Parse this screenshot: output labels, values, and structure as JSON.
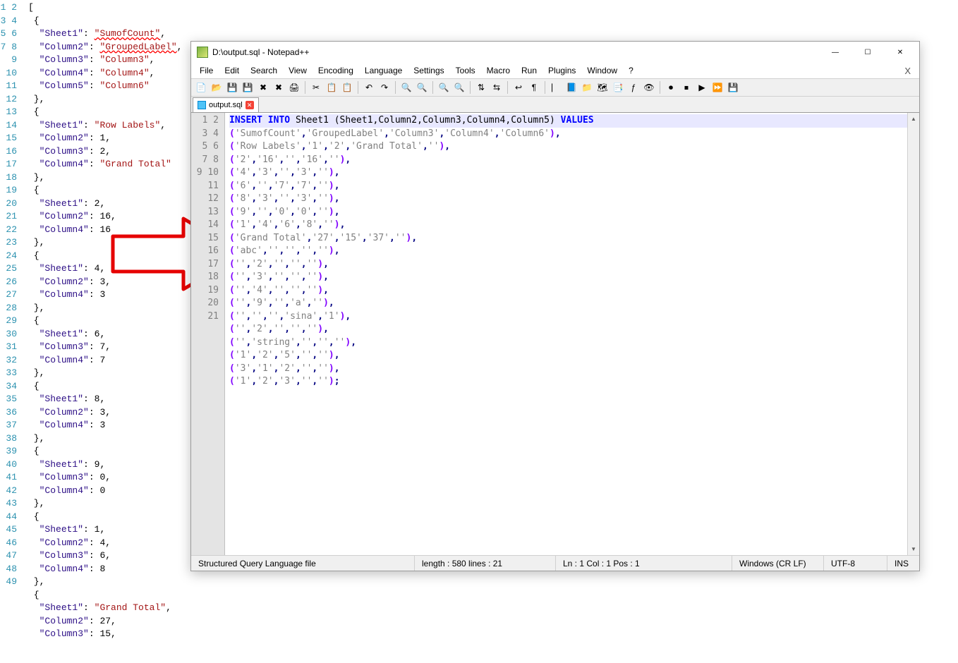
{
  "left_editor": {
    "lines": [
      {
        "n": 1,
        "raw": "["
      },
      {
        "n": 2,
        "raw": " {"
      },
      {
        "n": 3,
        "key": "Sheet1",
        "strval": "SumofCount",
        "comma": true,
        "squiggle": true
      },
      {
        "n": 4,
        "key": "Column2",
        "strval": "GroupedLabel",
        "comma": true,
        "squiggle": true
      },
      {
        "n": 5,
        "key": "Column3",
        "strval": "Column3",
        "comma": true
      },
      {
        "n": 6,
        "key": "Column4",
        "strval": "Column4",
        "comma": true
      },
      {
        "n": 7,
        "key": "Column5",
        "strval": "Column6"
      },
      {
        "n": 8,
        "raw": " },"
      },
      {
        "n": 9,
        "raw": " {"
      },
      {
        "n": 10,
        "key": "Sheet1",
        "strval": "Row Labels",
        "comma": true
      },
      {
        "n": 11,
        "key": "Column2",
        "numval": "1",
        "comma": true
      },
      {
        "n": 12,
        "key": "Column3",
        "numval": "2",
        "comma": true
      },
      {
        "n": 13,
        "key": "Column4",
        "strval": "Grand Total"
      },
      {
        "n": 14,
        "raw": " },"
      },
      {
        "n": 15,
        "raw": " {"
      },
      {
        "n": 16,
        "key": "Sheet1",
        "numval": "2",
        "comma": true
      },
      {
        "n": 17,
        "key": "Column2",
        "numval": "16",
        "comma": true
      },
      {
        "n": 18,
        "key": "Column4",
        "numval": "16"
      },
      {
        "n": 19,
        "raw": " },"
      },
      {
        "n": 20,
        "raw": " {"
      },
      {
        "n": 21,
        "key": "Sheet1",
        "numval": "4",
        "comma": true
      },
      {
        "n": 22,
        "key": "Column2",
        "numval": "3",
        "comma": true
      },
      {
        "n": 23,
        "key": "Column4",
        "numval": "3"
      },
      {
        "n": 24,
        "raw": " },"
      },
      {
        "n": 25,
        "raw": " {"
      },
      {
        "n": 26,
        "key": "Sheet1",
        "numval": "6",
        "comma": true
      },
      {
        "n": 27,
        "key": "Column3",
        "numval": "7",
        "comma": true
      },
      {
        "n": 28,
        "key": "Column4",
        "numval": "7"
      },
      {
        "n": 29,
        "raw": " },"
      },
      {
        "n": 30,
        "raw": " {"
      },
      {
        "n": 31,
        "key": "Sheet1",
        "numval": "8",
        "comma": true
      },
      {
        "n": 32,
        "key": "Column2",
        "numval": "3",
        "comma": true
      },
      {
        "n": 33,
        "key": "Column4",
        "numval": "3"
      },
      {
        "n": 34,
        "raw": " },"
      },
      {
        "n": 35,
        "raw": " {"
      },
      {
        "n": 36,
        "key": "Sheet1",
        "numval": "9",
        "comma": true
      },
      {
        "n": 37,
        "key": "Column3",
        "numval": "0",
        "comma": true
      },
      {
        "n": 38,
        "key": "Column4",
        "numval": "0"
      },
      {
        "n": 39,
        "raw": " },"
      },
      {
        "n": 40,
        "raw": " {"
      },
      {
        "n": 41,
        "key": "Sheet1",
        "numval": "1",
        "comma": true
      },
      {
        "n": 42,
        "key": "Column2",
        "numval": "4",
        "comma": true
      },
      {
        "n": 43,
        "key": "Column3",
        "numval": "6",
        "comma": true
      },
      {
        "n": 44,
        "key": "Column4",
        "numval": "8"
      },
      {
        "n": 45,
        "raw": " },"
      },
      {
        "n": 46,
        "raw": " {"
      },
      {
        "n": 47,
        "key": "Sheet1",
        "strval": "Grand Total",
        "comma": true
      },
      {
        "n": 48,
        "key": "Column2",
        "numval": "27",
        "comma": true
      },
      {
        "n": 49,
        "key": "Column3",
        "numval": "15",
        "comma": true
      }
    ]
  },
  "npp": {
    "title": "D:\\output.sql - Notepad++",
    "tab": "output.sql",
    "menus": [
      "File",
      "Edit",
      "Search",
      "View",
      "Encoding",
      "Language",
      "Settings",
      "Tools",
      "Macro",
      "Run",
      "Plugins",
      "Window",
      "?"
    ],
    "status": {
      "type": "Structured Query Language file",
      "length": "length : 580    lines : 21",
      "pos": "Ln : 1    Col : 1    Pos : 1",
      "eol": "Windows (CR LF)",
      "enc": "UTF-8",
      "ins": "INS"
    },
    "sql_header": {
      "kw1": "INSERT",
      "kw2": "INTO",
      "table": "Sheet1",
      "cols": "(Sheet1,Column2,Column3,Column4,Column5)",
      "kw3": "VALUES"
    },
    "sql_rows": [
      "('SumofCount','GroupedLabel','Column3','Column4','Column6'),",
      "('Row Labels','1','2','Grand Total',''),",
      "('2','16','','16',''),",
      "('4','3','','3',''),",
      "('6','','7','7',''),",
      "('8','3','','3',''),",
      "('9','','0','0',''),",
      "('1','4','6','8',''),",
      "('Grand Total','27','15','37',''),",
      "('abc','','','',''),",
      "('','2','','',''),",
      "('','3','','',''),",
      "('','4','','',''),",
      "('','9','','a',''),",
      "('','','','sina','1'),",
      "('','2','','',''),",
      "('','string','','',''),",
      "('1','2','5','',''),",
      "('3','1','2','',''),",
      "('1','2','3','','');"
    ]
  },
  "toolbar_icons": [
    "new-file-icon",
    "open-file-icon",
    "save-icon",
    "save-all-icon",
    "close-icon",
    "close-all-icon",
    "print-icon",
    "|",
    "cut-icon",
    "copy-icon",
    "paste-icon",
    "|",
    "undo-icon",
    "redo-icon",
    "|",
    "find-icon",
    "replace-icon",
    "|",
    "zoom-in-icon",
    "zoom-out-icon",
    "|",
    "sync-v-icon",
    "sync-h-icon",
    "|",
    "word-wrap-icon",
    "all-chars-icon",
    "|",
    "indent-guide-icon",
    "lang-icon",
    "folder-icon",
    "doc-map-icon",
    "doc-list-icon",
    "func-list-icon",
    "monitor-icon",
    "|",
    "record-icon",
    "stop-icon",
    "play-icon",
    "play-multi-icon",
    "save-macro-icon"
  ]
}
